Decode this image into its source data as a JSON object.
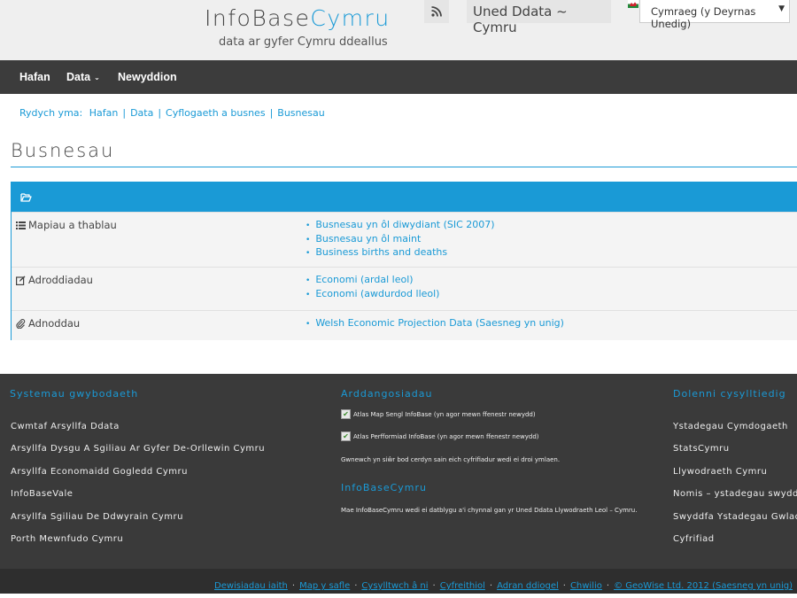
{
  "header": {
    "logo_part1": "InfoBase",
    "logo_part2": "Cymru",
    "tagline": "data ar gyfer Cymru ddeallus",
    "unit": "Uned Ddata ~ Cymru",
    "language": "Cymraeg (y Deyrnas Unedig)",
    "rss_icon": "rss-icon",
    "flag_icon": "welsh-flag-icon"
  },
  "nav": {
    "items": [
      "Hafan",
      "Data",
      "Newyddion"
    ]
  },
  "breadcrumb": {
    "prefix": "Rydych yma:",
    "items": [
      "Hafan",
      "Data",
      "Cyflogaeth a busnes",
      "Busnesau"
    ]
  },
  "page": {
    "title": "Busnesau"
  },
  "panel": {
    "rows": [
      {
        "label": "Mapiau a thablau",
        "icon": "list-icon",
        "links": [
          "Busnesau yn ôl diwydiant (SIC 2007)",
          "Busnesau yn ôl maint",
          "Business births and deaths"
        ]
      },
      {
        "label": "Adroddiadau",
        "icon": "edit-icon",
        "links": [
          "Economi (ardal leol)",
          "Economi (awdurdod lleol)"
        ]
      },
      {
        "label": "Adnoddau",
        "icon": "paperclip-icon",
        "links": [
          "Welsh Economic Projection Data (Saesneg yn unig)"
        ]
      }
    ]
  },
  "footer": {
    "col1": {
      "heading": "Systemau gwybodaeth",
      "links": [
        "Cwmtaf Arsyllfa Ddata",
        "Arsyllfa Dysgu A Sgiliau Ar Gyfer De-Orllewin Cymru",
        "Arsyllfa Economaidd Gogledd Cymru",
        "InfoBaseVale",
        "Arsyllfa Sgiliau De Ddwyrain Cymru",
        "Porth Mewnfudo Cymru"
      ]
    },
    "col2": {
      "heading": "Arddangosiadau",
      "items": [
        "Atlas Map Sengl InfoBase (yn agor mewn ffenestr newydd)",
        "Atlas Perfformiad InfoBase (yn agor mewn ffenestr newydd)"
      ],
      "note": "Gwnewch yn siŵr bod cerdyn sain eich cyfrifiadur wedi ei droi ymlaen.",
      "heading2": "InfoBaseCymru",
      "about": "Mae InfoBaseCymru wedi ei datblygu a'i chynnal gan yr Uned Ddata Llywodraeth Leol – Cymru."
    },
    "col3": {
      "heading": "Dolenni cysylltiedig",
      "links": [
        "Ystadegau Cymdogaeth",
        "StatsCymru",
        "Llywodraeth Cymru",
        "Nomis – ystadegau swyddogol",
        "Swyddfa Ystadegau Gwladol",
        "Cyfrifiad"
      ]
    },
    "bottom_links": [
      "Dewisiadau iaith",
      "Map y safle",
      "Cysylltwch â ni",
      "Cyfreithiol",
      "Adran ddiogel",
      "Chwilio",
      "© GeoWise Ltd. 2012 (Saesneg yn unig)"
    ]
  },
  "colors": {
    "accent": "#1a9ad6",
    "nav_bg": "#3c3c3c",
    "footer_bg": "#3a3a3a"
  }
}
